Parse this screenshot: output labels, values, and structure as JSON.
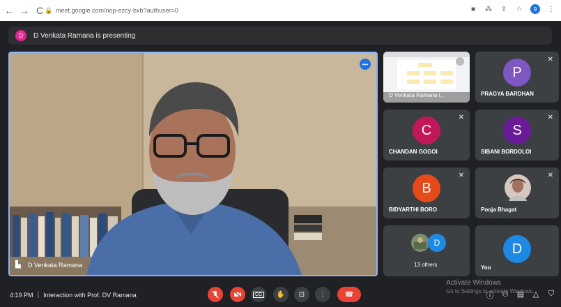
{
  "browser": {
    "url": "meet.google.com/nop-ezcy-bxb?authuser=0",
    "nav": {
      "back": "←",
      "forward": "→",
      "reload": "C"
    },
    "icons": {
      "camera": "■",
      "extensions": "⁂",
      "share": "⇪",
      "star": "☆",
      "profile_letter": "9",
      "menu": "⋮"
    }
  },
  "presenting": {
    "avatar_letter": "D",
    "text": "D Venkata Ramana is presenting"
  },
  "main": {
    "name": "D Venkata Ramana",
    "badge": "•••"
  },
  "participants": [
    {
      "name": "PRAGYA BARDHAN",
      "letter": "P",
      "color": "#7e57c2"
    },
    {
      "name": "CHANDAN GOGOI",
      "letter": "C",
      "color": "#c2185b"
    },
    {
      "name": "SIBANI BORDOLOI",
      "letter": "S",
      "color": "#6a1b9a"
    },
    {
      "name": "BIDYARTHI BORO",
      "letter": "B",
      "color": "#e64a19"
    },
    {
      "name": "Pooja Bhagat",
      "letter": ""
    },
    {
      "name": "13 others",
      "letter": "D",
      "color": "#1e88e5"
    },
    {
      "name": "You",
      "letter": "D",
      "color": "#1e88e5"
    }
  ],
  "screen_thumb": {
    "label": "D Venkata Ramana (..."
  },
  "meeting": {
    "time": "4:19 PM",
    "separator": "|",
    "title": "Interaction with Prof. DV Ramana"
  },
  "controls": {
    "mic": "mic-off",
    "camera": "camera-off",
    "captions": "CC",
    "hand": "✋",
    "present": "⊡",
    "more": "⋮",
    "hangup": "☎"
  },
  "watermark": {
    "line1": "Activate Windows",
    "line2": "Go to Settings to activate Windows."
  }
}
